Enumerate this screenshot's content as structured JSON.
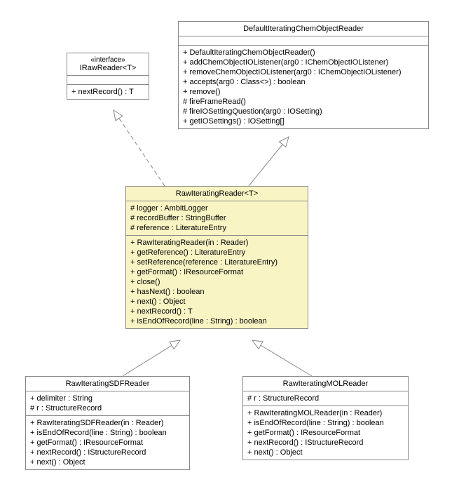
{
  "chart_data": {
    "type": "uml-class-diagram",
    "classes": [
      {
        "id": "IRawReader",
        "stereotype": "«interface»",
        "name": "IRawReader<T>",
        "attributes": [],
        "operations": [
          "+ nextRecord() : T"
        ]
      },
      {
        "id": "DefaultIteratingChemObjectReader",
        "name": "DefaultIteratingChemObjectReader",
        "attributes": [],
        "operations": [
          "+ DefaultIteratingChemObjectReader()",
          "+ addChemObjectIOListener(arg0 : IChemObjectIOListener)",
          "+ removeChemObjectIOListener(arg0 : IChemObjectIOListener)",
          "+ accepts(arg0 : Class<>) : boolean",
          "+ remove()",
          "# fireFrameRead()",
          "# fireIOSettingQuestion(arg0 : IOSetting)",
          "+ getIOSettings() : IOSetting[]"
        ]
      },
      {
        "id": "RawIteratingReader",
        "name": "RawIteratingReader<T>",
        "attributes": [
          "# logger : AmbitLogger",
          "# recordBuffer : StringBuffer",
          "# reference : LiteratureEntry"
        ],
        "operations": [
          "+ RawIteratingReader(in : Reader)",
          "+ getReference() : LiteratureEntry",
          "+ setReference(reference : LiteratureEntry)",
          "+ getFormat() : IResourceFormat",
          "+ close()",
          "+ hasNext() : boolean",
          "+ next() : Object",
          "+ nextRecord() : T",
          "+ isEndOfRecord(line : String) : boolean"
        ]
      },
      {
        "id": "RawIteratingSDFReader",
        "name": "RawIteratingSDFReader",
        "attributes": [
          "+ delimiter : String",
          "# r : StructureRecord"
        ],
        "operations": [
          "+ RawIteratingSDFReader(in : Reader)",
          "+ isEndOfRecord(line : String) : boolean",
          "+ getFormat() : IResourceFormat",
          "+ nextRecord() : IStructureRecord",
          "+ next() : Object"
        ]
      },
      {
        "id": "RawIteratingMOLReader",
        "name": "RawIteratingMOLReader",
        "attributes": [
          "# r : StructureRecord"
        ],
        "operations": [
          "+ RawIteratingMOLReader(in : Reader)",
          "+ isEndOfRecord(line : String) : boolean",
          "+ getFormat() : IResourceFormat",
          "+ nextRecord() : IStructureRecord",
          "+ next() : Object"
        ]
      }
    ],
    "relationships": [
      {
        "from": "RawIteratingReader",
        "to": "IRawReader",
        "type": "realization"
      },
      {
        "from": "RawIteratingReader",
        "to": "DefaultIteratingChemObjectReader",
        "type": "generalization"
      },
      {
        "from": "RawIteratingSDFReader",
        "to": "RawIteratingReader",
        "type": "generalization"
      },
      {
        "from": "RawIteratingMOLReader",
        "to": "RawIteratingReader",
        "type": "generalization"
      }
    ]
  }
}
